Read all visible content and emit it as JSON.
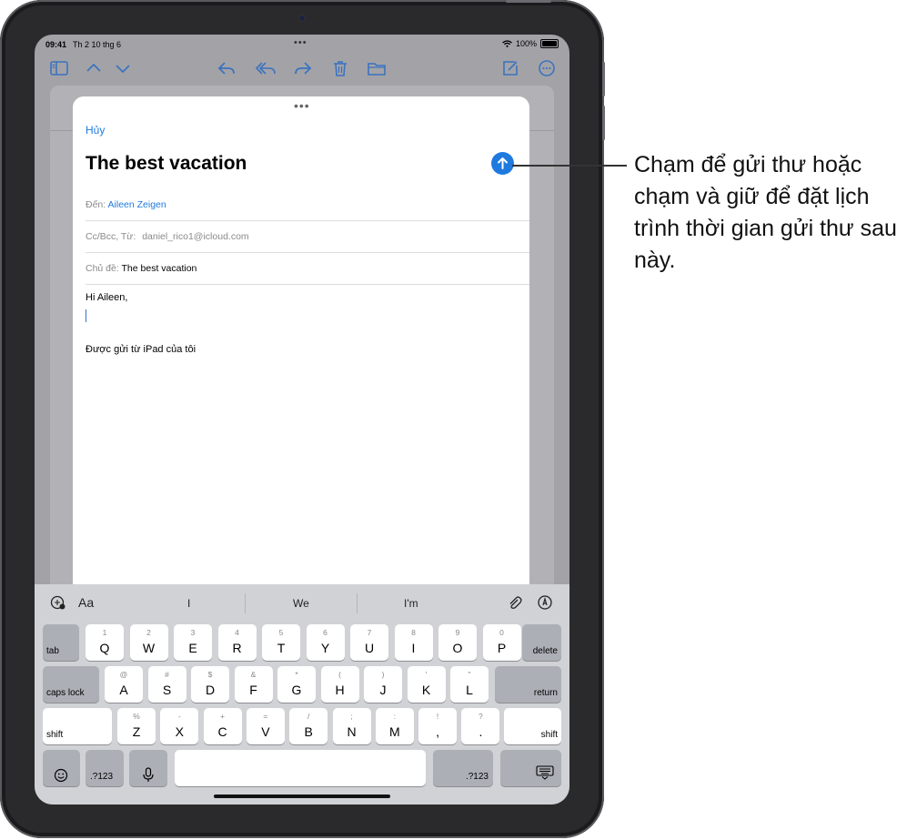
{
  "status_bar": {
    "time": "09:41",
    "date": "Th 2 10 thg 6",
    "battery": "100%"
  },
  "compose": {
    "cancel_label": "Hủy",
    "subject_title": "The best vacation",
    "to_label": "Đến:",
    "to_value": "Aileen Zeigen",
    "ccbcc_label": "Cc/Bcc, Từ:",
    "from_value": "daniel_rico1@icloud.com",
    "subject_label": "Chủ đề:",
    "subject_value": "The best vacation",
    "body_greeting": "Hi Aileen,",
    "signature": "Được gửi từ iPad của tôi"
  },
  "keyboard": {
    "aa_label": "Aa",
    "suggestions": [
      "I",
      "We",
      "I'm"
    ],
    "row1": [
      {
        "k": "Q",
        "a": "1"
      },
      {
        "k": "W",
        "a": "2"
      },
      {
        "k": "E",
        "a": "3"
      },
      {
        "k": "R",
        "a": "4"
      },
      {
        "k": "T",
        "a": "5"
      },
      {
        "k": "Y",
        "a": "6"
      },
      {
        "k": "U",
        "a": "7"
      },
      {
        "k": "I",
        "a": "8"
      },
      {
        "k": "O",
        "a": "9"
      },
      {
        "k": "P",
        "a": "0"
      }
    ],
    "row2": [
      {
        "k": "A",
        "a": "@"
      },
      {
        "k": "S",
        "a": "#"
      },
      {
        "k": "D",
        "a": "$"
      },
      {
        "k": "F",
        "a": "&"
      },
      {
        "k": "G",
        "a": "*"
      },
      {
        "k": "H",
        "a": "("
      },
      {
        "k": "J",
        "a": ")"
      },
      {
        "k": "K",
        "a": "'"
      },
      {
        "k": "L",
        "a": "\""
      }
    ],
    "row3": [
      {
        "k": "Z",
        "a": "%"
      },
      {
        "k": "X",
        "a": "-"
      },
      {
        "k": "C",
        "a": "+"
      },
      {
        "k": "V",
        "a": "="
      },
      {
        "k": "B",
        "a": "/"
      },
      {
        "k": "N",
        "a": ";"
      },
      {
        "k": "M",
        "a": ":"
      },
      {
        "k": ",",
        "a": "!"
      },
      {
        "k": ".",
        "a": "?"
      }
    ],
    "tab_label": "tab",
    "delete_label": "delete",
    "caps_label": "caps lock",
    "return_label": "return",
    "shift_label": "shift",
    "num_label": ".?123"
  },
  "callout_text": "Chạm để gửi thư hoặc chạm và giữ để đặt lịch trình thời gian gửi thư sau này.",
  "colors": {
    "accent": "#1f7ae0",
    "keyboard_bg": "#d1d2d6",
    "dark_key": "#acafb6"
  }
}
